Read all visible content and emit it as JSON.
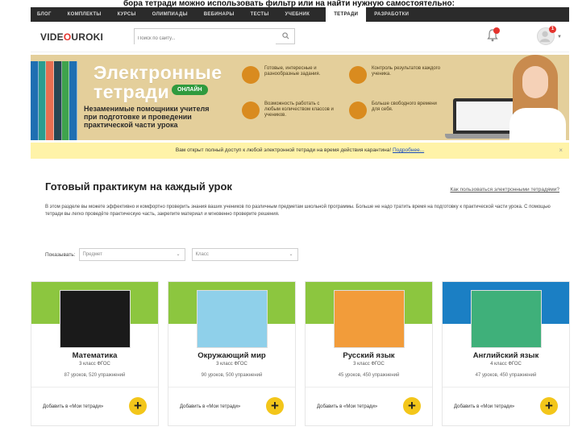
{
  "caption": "бора тетради можно использовать фильтр или на найти нужную самостоятельно:",
  "nav": [
    "Блог",
    "Комплекты",
    "Курсы",
    "Олимпиады",
    "Вебинары",
    "Тесты",
    "Учебник",
    "Тетради",
    "Разработки"
  ],
  "nav_active": "Тетради",
  "header": {
    "logo_left": "VIDE",
    "logo_o": "O",
    "logo_right": "UROKI",
    "search_placeholder": "Поиск по сайту...",
    "notifications": "",
    "avatar_badge": "1"
  },
  "banner": {
    "title_1": "Электронные",
    "title_2": "тетради",
    "badge": "онлайн",
    "subtitle": "Незаменимые помощники учителя при подготовке и проведении практической части урока",
    "features": [
      "Готовые, интересные и разнообразные задания.",
      "Возможность работать с любым количеством классов и учеников.",
      "Контроль результатов каждого ученика.",
      "Больше свободного времени для себя."
    ],
    "book_colors": [
      "#1f6fb2",
      "#2a9d8f",
      "#e76f51",
      "#264653",
      "#3fa34d",
      "#1f6fb2"
    ]
  },
  "notice": {
    "text": "Вам открыт полный доступ к любой электронной тетради на время действия карантина!",
    "link": "Подробнее...",
    "close": "×"
  },
  "content": {
    "title": "Готовый практикум на каждый урок",
    "help_link": "Как пользоваться электронными тетрадями?",
    "description": "В этом разделе вы можете эффективно и комфортно проверить знания ваших учеников по различным предметам школьной программы. Больше не надо тратить время на подготовку к практической части урока. С помощью тетради вы легко проведёте практическую часть, закрепите материал и мгновенно проверите решения.",
    "filter_label": "Показывать:",
    "filter_subject": "Предмет",
    "filter_grade": "Класс"
  },
  "cards": [
    {
      "name": "Математика",
      "grade": "3 класс ФГОС",
      "stats": "87 уроков, 520 упражнений",
      "add": "Добавить в «Мои тетради»",
      "band": "#8cc63f",
      "pic": "#1a1a1a"
    },
    {
      "name": "Окружающий мир",
      "grade": "3 класс ФГОС",
      "stats": "90 уроков, 500 упражнений",
      "add": "Добавить в «Мои тетради»",
      "band": "#8cc63f",
      "pic": "#8fd0ea"
    },
    {
      "name": "Русский язык",
      "grade": "3 класс ФГОС",
      "stats": "45 уроков, 450 упражнений",
      "add": "Добавить в «Мои тетради»",
      "band": "#8cc63f",
      "pic": "#f29c3a"
    },
    {
      "name": "Английский язык",
      "grade": "4 класс ФГОС",
      "stats": "47 уроков, 450 упражнений",
      "add": "Добавить в «Мои тетради»",
      "band": "#1b7fc4",
      "pic": "#3fb07a"
    }
  ]
}
